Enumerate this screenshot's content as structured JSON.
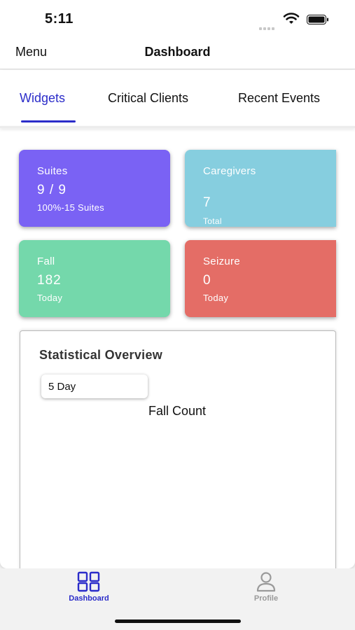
{
  "status_bar": {
    "time": "5:11"
  },
  "nav": {
    "menu_label": "Menu",
    "title": "Dashboard"
  },
  "tabs": [
    {
      "label": "Widgets",
      "active": true
    },
    {
      "label": "Critical Clients",
      "active": false
    },
    {
      "label": "Recent Events",
      "active": false
    }
  ],
  "widgets": {
    "suites": {
      "title": "Suites",
      "value": "9 / 9",
      "sub": "100%-15 Suites",
      "color": "#7a62f4"
    },
    "caregivers": {
      "title": "Caregivers",
      "value": "7",
      "sub": "Total",
      "color": "#86cedf"
    },
    "fall": {
      "title": "Fall",
      "value": "182",
      "sub": "Today",
      "color": "#74d8ab"
    },
    "seizure": {
      "title": "Seizure",
      "value": "0",
      "sub": "Today",
      "color": "#e46d66"
    }
  },
  "stats": {
    "title": "Statistical Overview",
    "range": "5 Day",
    "chart_title": "Fall Count"
  },
  "tab_bar": {
    "dashboard_label": "Dashboard",
    "profile_label": "Profile",
    "accent": "#2b2cc9",
    "inactive": "#9a9a9a"
  },
  "icons": {
    "dashboard": "grid-icon",
    "profile": "user-icon",
    "wifi": "wifi-icon",
    "battery": "battery-icon"
  }
}
